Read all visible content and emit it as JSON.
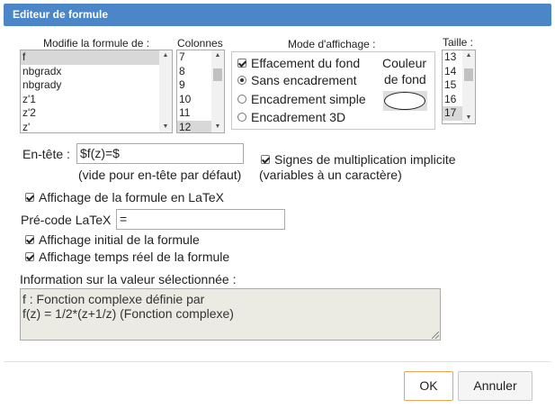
{
  "dialog": {
    "title": "Editeur de formule"
  },
  "formula_list": {
    "label": "Modifie la formule de :",
    "items": [
      "f",
      "nbgradx",
      "nbgrady",
      "z'1",
      "z'2",
      "z'"
    ],
    "selected": "f"
  },
  "columns": {
    "label": "Colonnes",
    "items": [
      "7",
      "8",
      "9",
      "10",
      "11",
      "12"
    ],
    "selected": "12"
  },
  "display_mode": {
    "label": "Mode d'affichage :",
    "clear_background_label": "Effacement du fond",
    "clear_background_checked": true,
    "options": [
      "Sans encadrement",
      "Encadrement simple",
      "Encadrement 3D"
    ],
    "selected": "Sans encadrement",
    "bg_color_label_line1": "Couleur",
    "bg_color_label_line2": "de fond"
  },
  "size": {
    "label": "Taille :",
    "items": [
      "13",
      "14",
      "15",
      "16",
      "17"
    ],
    "selected": "17"
  },
  "header": {
    "label": "En-tête :",
    "value": "$f(z)=$",
    "hint": "(vide pour en-tête par défaut)"
  },
  "implicit_mult": {
    "label": "Signes de multiplication implicite",
    "hint": "(variables à un caractère)",
    "checked": true
  },
  "latex_display": {
    "label": "Affichage de la formule en LaTeX",
    "checked": true
  },
  "latex_precode": {
    "label": "Pré-code LaTeX",
    "value": "="
  },
  "initial_display": {
    "label": "Affichage initial de la formule",
    "checked": true
  },
  "realtime_display": {
    "label": "Affichage temps réel de la formule",
    "checked": true
  },
  "info": {
    "label": "Information sur la valeur sélectionnée :",
    "line1": "f : Fonction complexe définie par",
    "line2": "f(z) = 1/2*(z+1/z) (Fonction complexe)"
  },
  "buttons": {
    "ok": "OK",
    "cancel": "Annuler"
  }
}
